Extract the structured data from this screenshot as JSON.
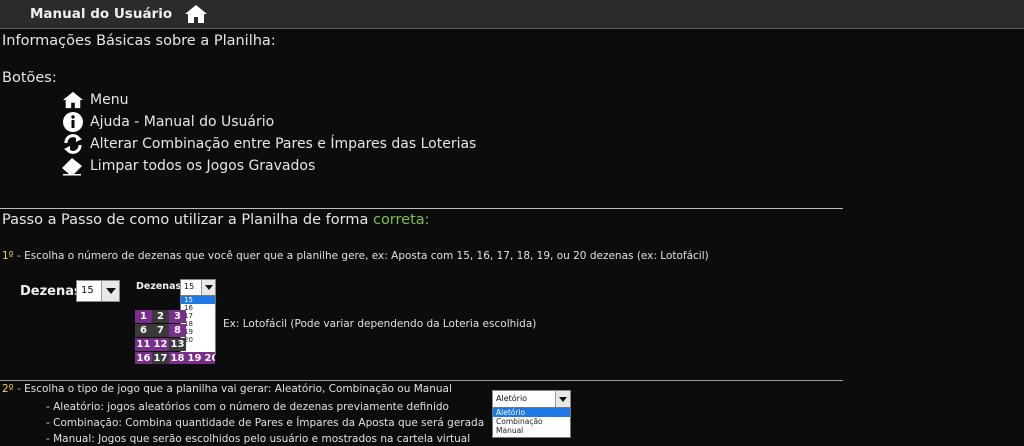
{
  "header": {
    "title": "Manual do Usuário",
    "home_icon": "home-icon"
  },
  "intro": {
    "heading": "Informações Básicas sobre a Planilha:",
    "buttons_heading": "Botões:"
  },
  "buttons": [
    {
      "icon": "home-icon",
      "label": "Menu"
    },
    {
      "icon": "info-icon",
      "label": "Ajuda - Manual do Usuário"
    },
    {
      "icon": "refresh-icon",
      "label": "Alterar Combinação entre Pares e Ímpares das Loterias"
    },
    {
      "icon": "eraser-icon",
      "label": "Limpar todos os Jogos Gravados"
    }
  ],
  "steps": {
    "heading": "Passo a Passo de como utilizar a Planilha de forma ",
    "heading_accent": "correta:",
    "step1": {
      "num": "1º -",
      "text": " Escolha o número de dezenas que você quer que a planilhe gere, ex: Aposta com 15, 16, 17, 18, 19, ou 20 dezenas (ex: Lotofácil)",
      "label": "Dezenas",
      "value": "15",
      "small_label": "Dezenas",
      "small_value": "15",
      "options": [
        "15",
        "16",
        "17",
        "18",
        "19",
        "20"
      ],
      "grid_numbers": [
        "1",
        "2",
        "3",
        "6",
        "7",
        "8",
        "11",
        "12",
        "13",
        "16",
        "17",
        "18",
        "19",
        "20"
      ],
      "example": "Ex: Lotofácil (Pode variar dependendo da Loteria escolhida)"
    },
    "step2": {
      "num": "2º -",
      "text": " Escolha o tipo de jogo que a planilha vai gerar: Aleatório, Combinação ou Manual",
      "items": [
        "- Aleatório: jogos aleatórios com o número de dezenas previamente definido",
        "- Combinação: Combina quantidade de Pares e Ímpares da Aposta que será gerada",
        "- Manual: Jogos que serão escolhidos pelo usuário e mostrados na cartela virtual"
      ],
      "value": "Aletório",
      "options": [
        "Aletório",
        "Combinação",
        "Manual"
      ]
    }
  },
  "colors": {
    "background": "#0c0c0c",
    "accent_green": "#7cc24a",
    "accent_yellow": "#e6d84a",
    "lottery_purple": "#7a2e8c",
    "selection_blue": "#1e78e6"
  }
}
